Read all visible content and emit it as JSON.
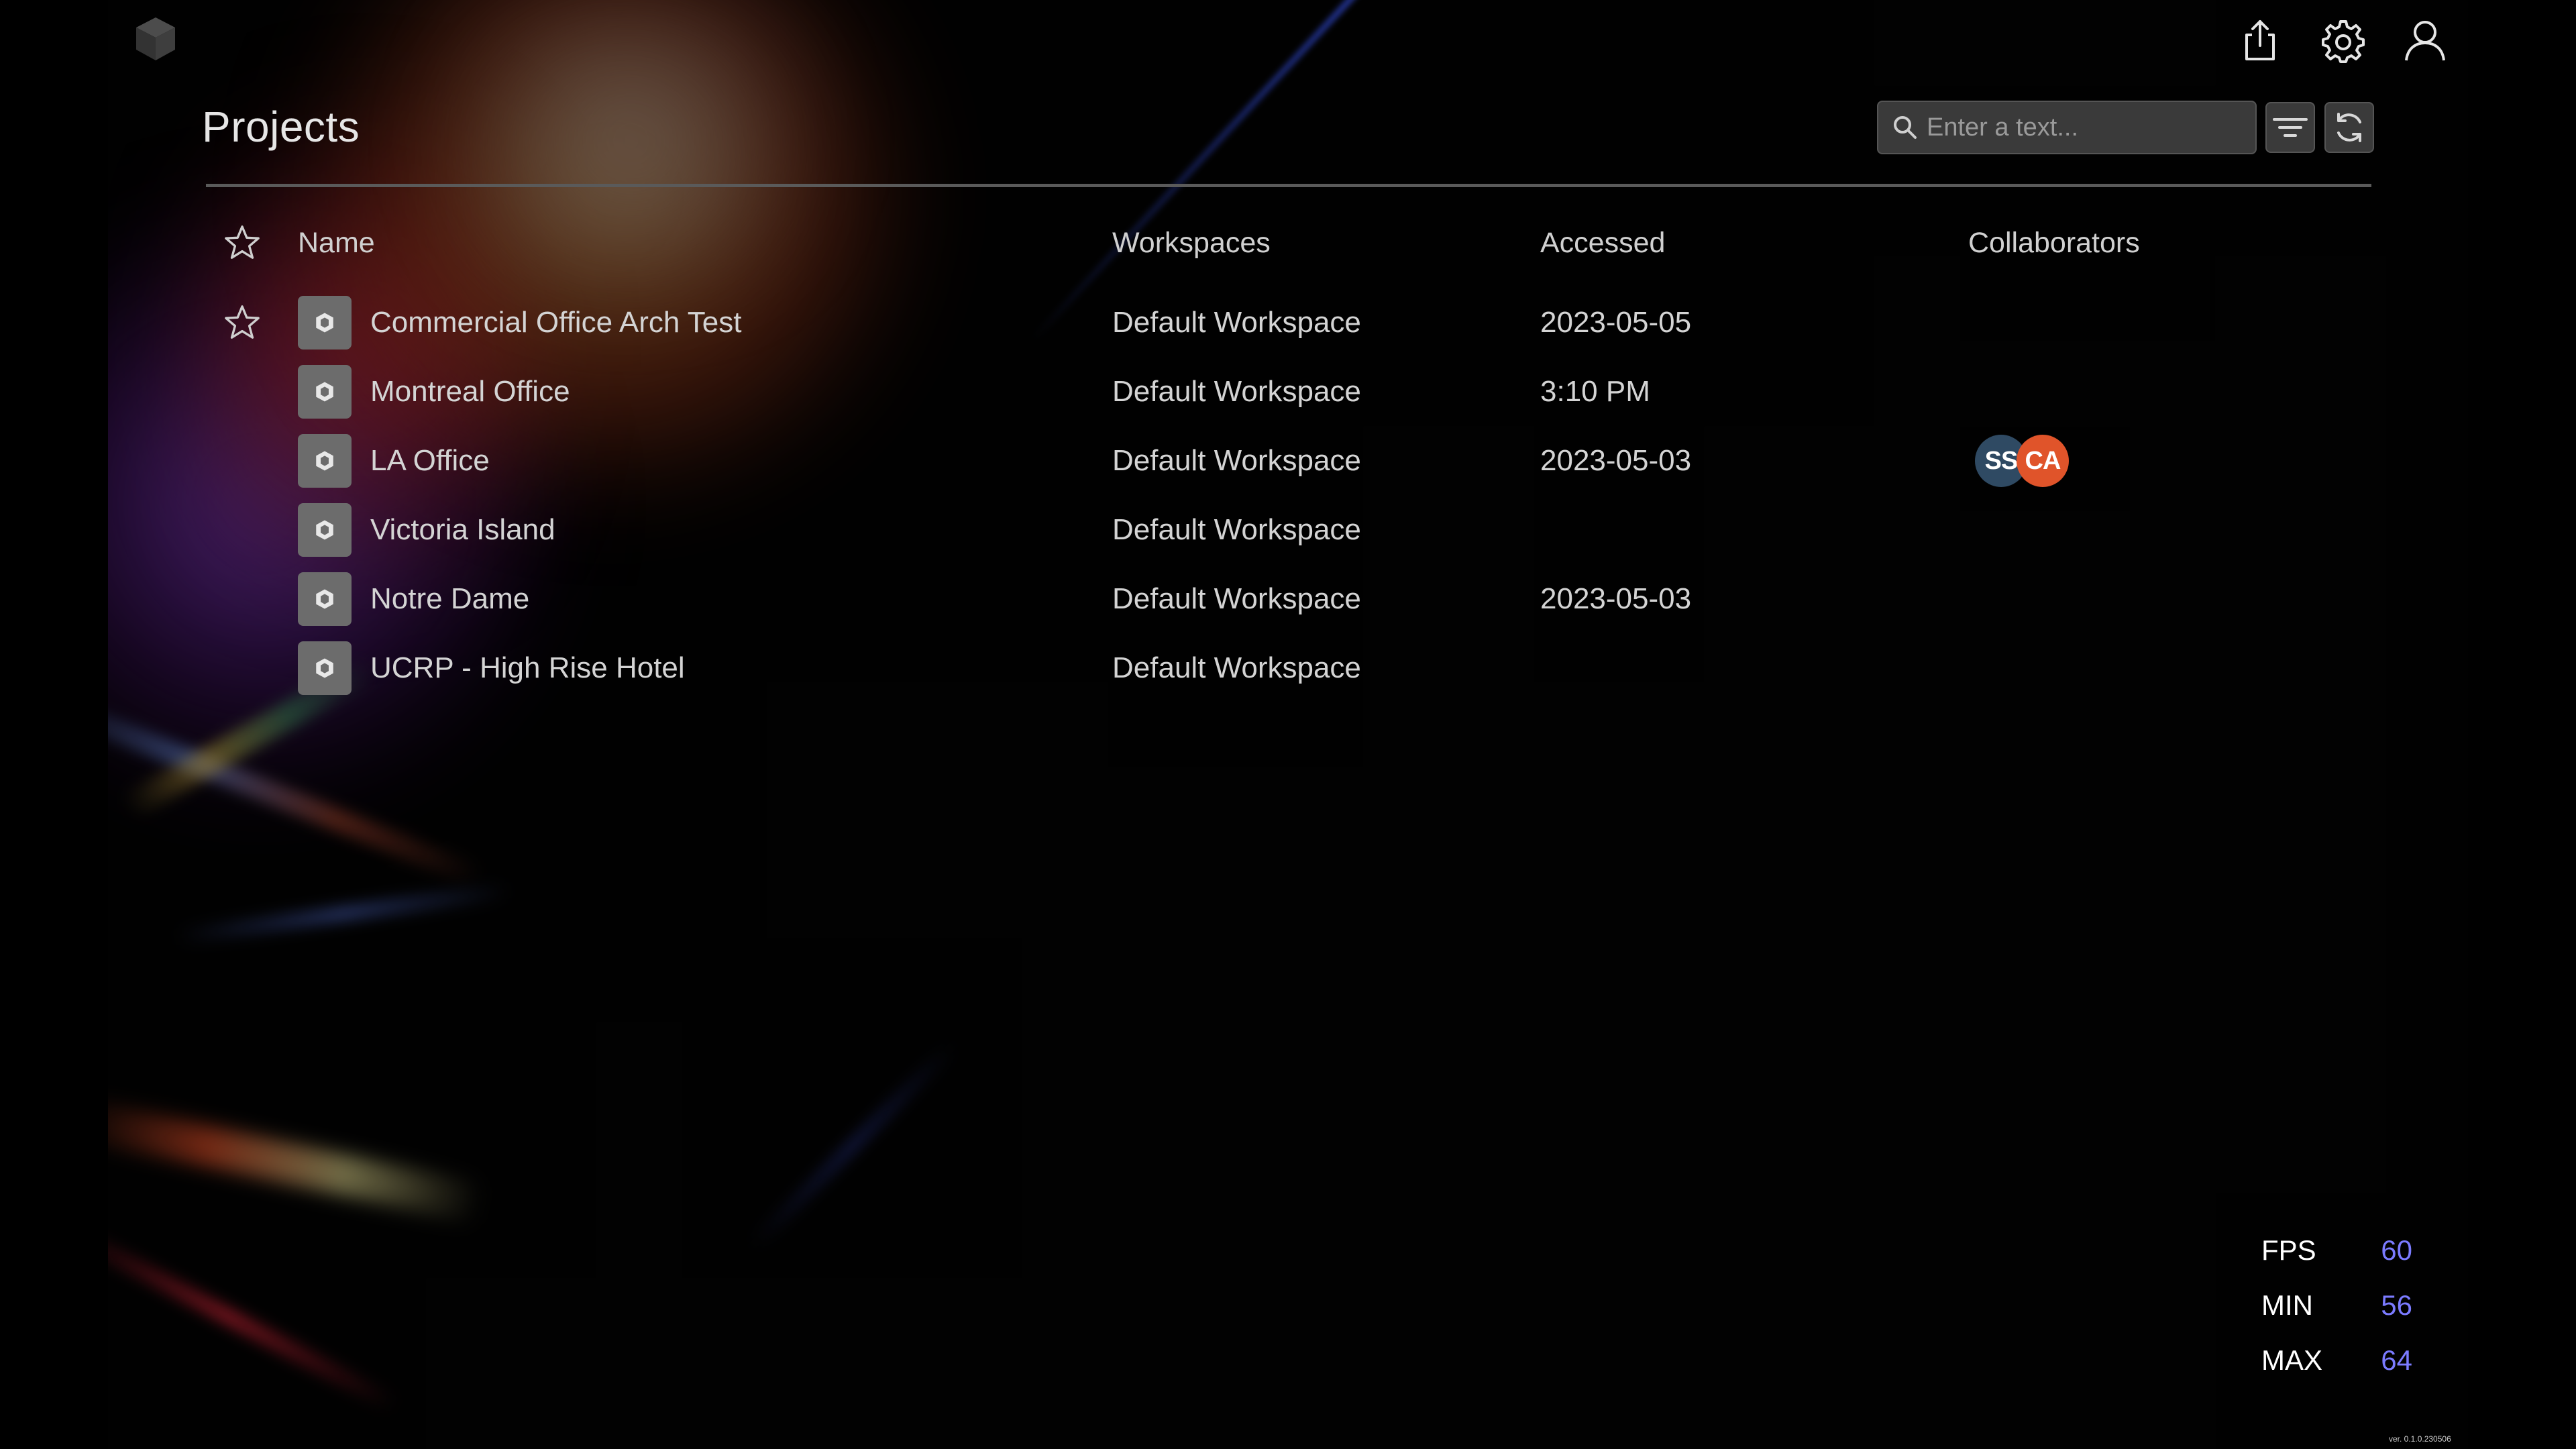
{
  "header": {
    "title": "Projects",
    "search_placeholder": "Enter a text..."
  },
  "table": {
    "columns": [
      "Name",
      "Workspaces",
      "Accessed",
      "Collaborators"
    ],
    "rows": [
      {
        "name": "Commercial Office Arch Test",
        "workspace": "Default Workspace",
        "accessed": "2023-05-05",
        "starred": true
      },
      {
        "name": "Montreal Office",
        "workspace": "Default Workspace",
        "accessed": "3:10 PM",
        "starred": false
      },
      {
        "name": "LA Office",
        "workspace": "Default Workspace",
        "accessed": "2023-05-03",
        "starred": false,
        "collaborators": [
          {
            "initials": "SS",
            "color": "#2f4a63"
          },
          {
            "initials": "CA",
            "color": "#e0542a"
          }
        ]
      },
      {
        "name": "Victoria Island",
        "workspace": "Default Workspace",
        "accessed": "",
        "starred": false
      },
      {
        "name": "Notre Dame",
        "workspace": "Default Workspace",
        "accessed": "2023-05-03",
        "starred": false
      },
      {
        "name": "UCRP - High Rise Hotel",
        "workspace": "Default Workspace",
        "accessed": "",
        "starred": false
      }
    ]
  },
  "stats": {
    "fps_label": "FPS",
    "fps": "60",
    "min_label": "MIN",
    "min": "56",
    "max_label": "MAX",
    "max": "64",
    "value_color": "#7b7bff"
  },
  "version": "ver. 0.1.0.230506",
  "icons": {
    "logo": "cube-logo-icon",
    "share": "share-icon",
    "settings": "gear-icon",
    "account": "user-icon",
    "search": "search-icon",
    "filter": "filter-icon",
    "refresh": "refresh-icon",
    "star": "star-icon",
    "project": "cube-icon"
  }
}
